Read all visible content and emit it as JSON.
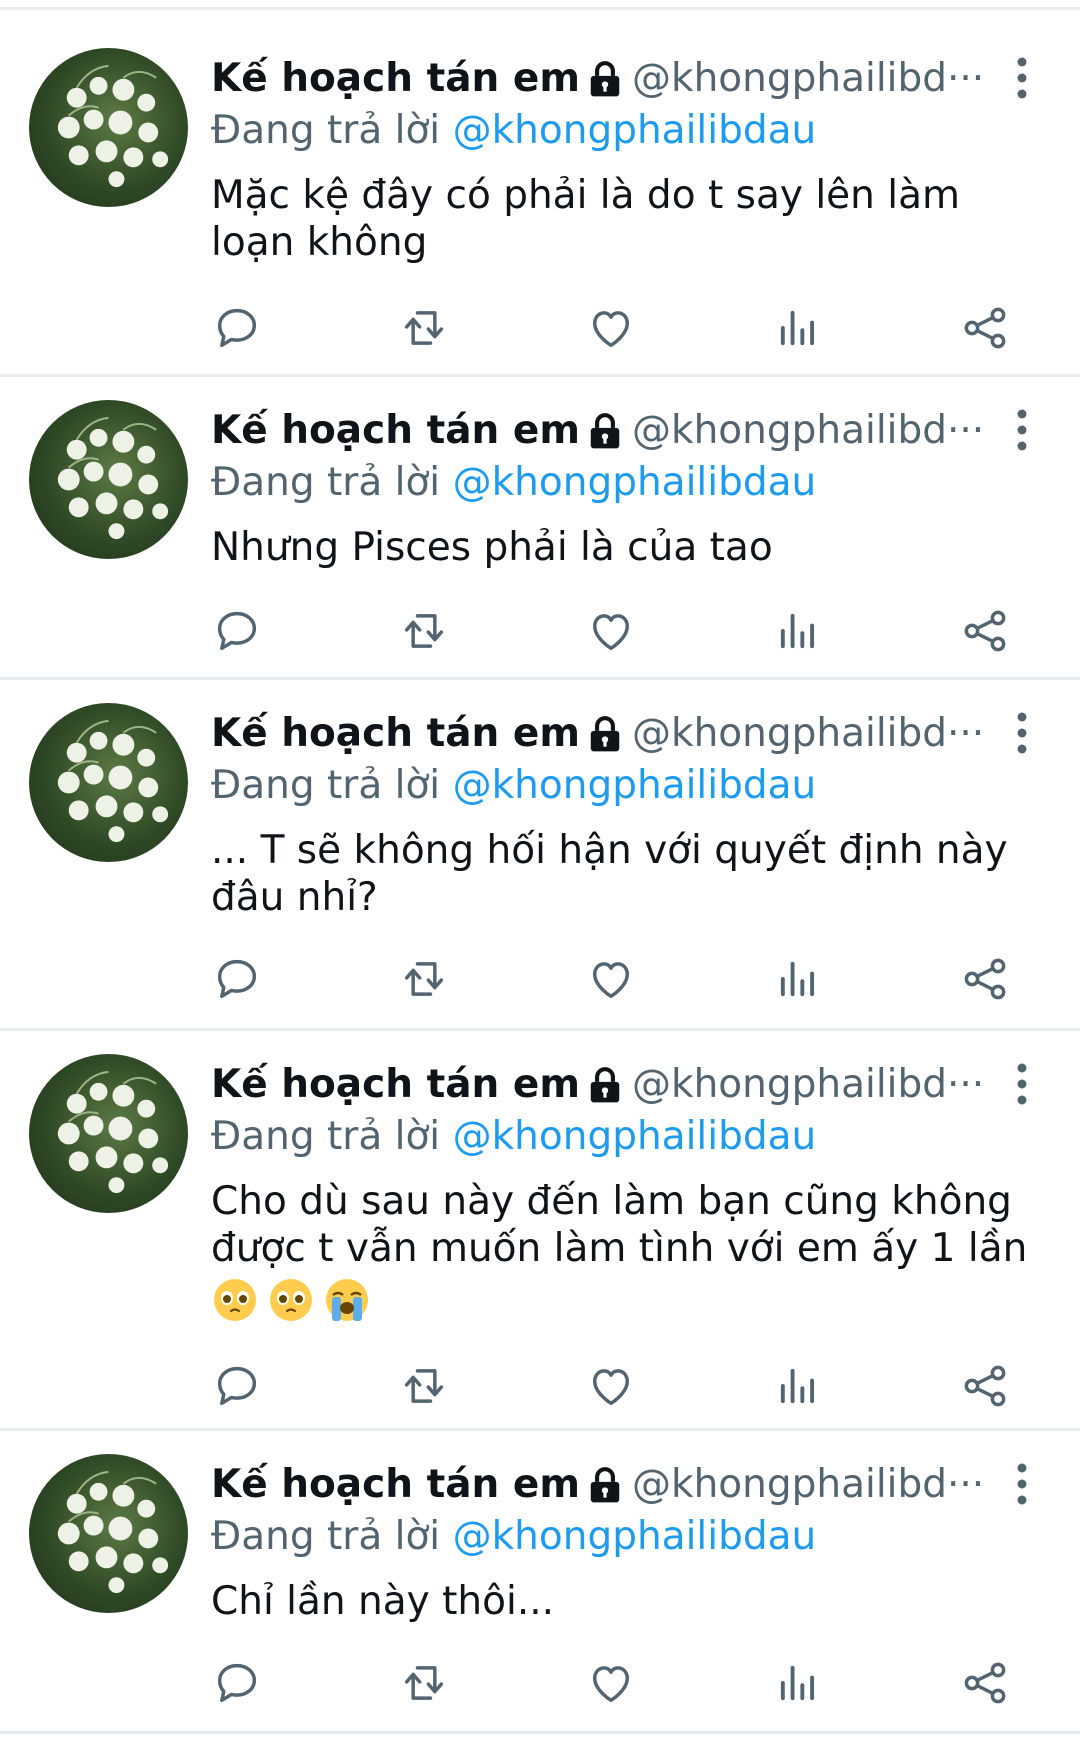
{
  "tweets": [
    {
      "name": "Kế hoạch tán em",
      "handle": "@khongphailibd···",
      "reply_prefix": "Đang trả lời",
      "reply_to": "@khongphailibdau",
      "text": "Mặc kệ đây có phải là do t say lên làm loạn không"
    },
    {
      "name": "Kế hoạch tán em",
      "handle": "@khongphailibd···",
      "reply_prefix": "Đang trả lời",
      "reply_to": "@khongphailibdau",
      "text": "Nhưng Pisces phải là của tao"
    },
    {
      "name": "Kế hoạch tán em",
      "handle": "@khongphailibd···",
      "reply_prefix": "Đang trả lời",
      "reply_to": "@khongphailibdau",
      "text": "... T sẽ không hối hận với quyết định này đâu nhỉ?"
    },
    {
      "name": "Kế hoạch tán em",
      "handle": "@khongphailibd···",
      "reply_prefix": "Đang trả lời",
      "reply_to": "@khongphailibdau",
      "text": "Cho dù sau này đến làm bạn cũng không được t vẫn muốn làm tình với em ấy 1 lần",
      "emojis": [
        "pleading-face",
        "pleading-face",
        "loudly-crying-face"
      ]
    },
    {
      "name": "Kế hoạch tán em",
      "handle": "@khongphailibd···",
      "reply_prefix": "Đang trả lời",
      "reply_to": "@khongphailibdau",
      "text": "Chỉ lần này thôi..."
    }
  ],
  "icons": {
    "lock": "lock-icon",
    "more": "more-vertical-icon",
    "actions": [
      "reply-icon",
      "retweet-icon",
      "like-icon",
      "analytics-icon",
      "share-icon"
    ]
  },
  "colors": {
    "link": "#1d9bf0",
    "secondary_text": "#536471",
    "primary_text": "#0f1419",
    "divider": "#e6ecf0"
  }
}
